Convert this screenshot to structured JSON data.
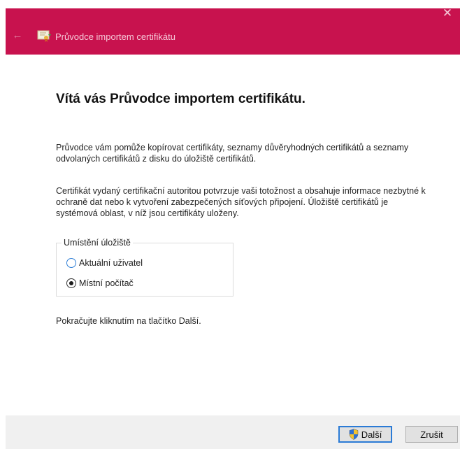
{
  "window": {
    "title": "Průvodce importem certifikátu",
    "close_symbol": "✕",
    "back_symbol": "←",
    "titlebar_color": "#c8124e",
    "icon": "certificate-icon"
  },
  "main": {
    "heading": "Vítá vás Průvodce importem certifikátu.",
    "paragraph1": "Průvodce vám pomůže kopírovat certifikáty, seznamy důvěryhodných certifikátů a seznamy odvolaných certifikátů z disku do úložiště certifikátů.",
    "paragraph2": "Certifikát vydaný certifikační autoritou potvrzuje vaši totožnost a obsahuje informace nezbytné k ochraně dat nebo k vytvoření zabezpečených síťových připojení. Úložiště certifikátů je systémová oblast, v níž jsou certifikáty uloženy.",
    "store_location": {
      "legend": "Umístění úložiště",
      "options": [
        {
          "label": "Aktuální uživatel",
          "selected": false
        },
        {
          "label": "Místní počítač",
          "selected": true
        }
      ]
    },
    "continue_text": "Pokračujte kliknutím na tlačítko Další."
  },
  "footer": {
    "next_label": "Další",
    "next_icon": "uac-shield-icon",
    "cancel_label": "Zrušit"
  }
}
